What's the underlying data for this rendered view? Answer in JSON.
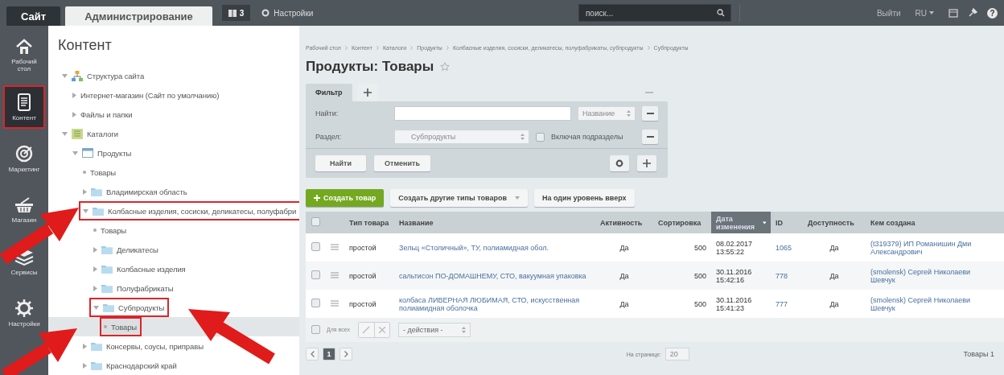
{
  "top_bar": {
    "tabs": [
      {
        "label": "Сайт",
        "selected": false
      },
      {
        "label": "Администрирование",
        "selected": true
      }
    ],
    "notifications": "3",
    "settings_link": "Настройки",
    "search": {
      "placeholder": "поиск..."
    },
    "logout": "Выйти",
    "language": "RU",
    "help": "?"
  },
  "rail": [
    {
      "label": "Рабочий стол",
      "kind": "home",
      "selected": false,
      "annotated": false
    },
    {
      "label": "Контент",
      "kind": "document",
      "selected": true,
      "annotated": true
    },
    {
      "label": "Маркетинг",
      "kind": "target",
      "selected": false,
      "annotated": false
    },
    {
      "label": "Магазин",
      "kind": "basket",
      "selected": false,
      "annotated": false
    },
    {
      "label": "Сервисы",
      "kind": "layers",
      "selected": false,
      "annotated": false
    },
    {
      "label": "Настройки",
      "kind": "gear",
      "selected": false,
      "annotated": false
    }
  ],
  "tree": {
    "title": "Контент",
    "items": [
      {
        "label": "Структура сайта",
        "kind": "structure",
        "expanded": true,
        "selected": false,
        "annotated": false,
        "children": [
          {
            "label": "Интернет-магазин (Сайт по умолчанию)",
            "kind": "plain",
            "expanded": false,
            "selected": false,
            "annotated": false
          },
          {
            "label": "Файлы и папки",
            "kind": "plain",
            "expanded": false,
            "selected": false,
            "annotated": false
          }
        ]
      },
      {
        "label": "Каталоги",
        "kind": "catalog",
        "expanded": true,
        "selected": false,
        "annotated": false,
        "children": [
          {
            "label": "Продукты",
            "kind": "iblock",
            "expanded": true,
            "selected": false,
            "annotated": false,
            "children": [
              {
                "label": "Товары",
                "kind": "leaf",
                "selected": false,
                "annotated": false
              },
              {
                "label": "Владимирская область",
                "kind": "folder",
                "expanded": false,
                "selected": false,
                "annotated": false
              },
              {
                "label": "Колбасные изделия, сосиски, деликатесы, полуфабри",
                "kind": "folder",
                "expanded": true,
                "selected": false,
                "annotated": true,
                "children": [
                  {
                    "label": "Товары",
                    "kind": "leaf",
                    "selected": false,
                    "annotated": false
                  },
                  {
                    "label": "Деликатесы",
                    "kind": "folder",
                    "expanded": false,
                    "selected": false,
                    "annotated": false
                  },
                  {
                    "label": "Колбасные изделия",
                    "kind": "folder",
                    "expanded": false,
                    "selected": false,
                    "annotated": false
                  },
                  {
                    "label": "Полуфабрикаты",
                    "kind": "folder",
                    "expanded": false,
                    "selected": false,
                    "annotated": false
                  },
                  {
                    "label": "Субпродукты",
                    "kind": "folder",
                    "expanded": true,
                    "selected": false,
                    "annotated": true,
                    "children": [
                      {
                        "label": "Товары",
                        "kind": "leaf",
                        "selected": true,
                        "annotated": true
                      }
                    ]
                  }
                ]
              },
              {
                "label": "Консервы, соусы, приправы",
                "kind": "folder",
                "expanded": false,
                "selected": false,
                "annotated": false
              },
              {
                "label": "Краснодарский край",
                "kind": "folder",
                "expanded": false,
                "selected": false,
                "annotated": false
              }
            ]
          }
        ]
      }
    ]
  },
  "breadcrumb": [
    "Рабочий стол",
    "Контент",
    "Каталоги",
    "Продукты",
    "Колбасные изделия, сосиски, деликатесы, полуфабрикаты, субпродукты",
    "Субпродукты"
  ],
  "page_title": "Продукты: Товары",
  "filter": {
    "tabs": [
      {
        "label": "Фильтр",
        "selected": true
      }
    ],
    "rows": [
      {
        "label": "Найти:",
        "kind": "search",
        "select": "Название"
      },
      {
        "label": "Раздел:",
        "kind": "section",
        "select": "Субпродукты",
        "checkbox": {
          "label": "Включая подразделы",
          "checked": false
        }
      }
    ],
    "buttons": [
      "Найти",
      "Отменить"
    ]
  },
  "toolbar": [
    {
      "label": "Создать товар",
      "kind": "primary"
    },
    {
      "label": "Создать другие типы товаров",
      "kind": "dropdown"
    },
    {
      "label": "На один уровень вверх",
      "kind": "plain"
    }
  ],
  "table": {
    "select_all": {
      "checked": false
    },
    "columns": [
      {
        "label": "Тип товара",
        "kind": "text",
        "sorted": false
      },
      {
        "label": "Название",
        "kind": "link",
        "sorted": false
      },
      {
        "label": "Активность",
        "kind": "center",
        "sorted": false
      },
      {
        "label": "Сортировка",
        "kind": "number",
        "sorted": false
      },
      {
        "label": "Дата изменения",
        "kind": "text",
        "sorted": true
      },
      {
        "label": "ID",
        "kind": "link",
        "sorted": false
      },
      {
        "label": "Доступность",
        "kind": "center",
        "sorted": false
      },
      {
        "label": "Кем создана",
        "kind": "link",
        "sorted": false
      }
    ],
    "rows": [
      {
        "checked": false,
        "cells": [
          "простой",
          "Зельц «Столичный», ТУ, полиамидная обол.",
          "Да",
          "500",
          "08.02.2017\n13:55:22",
          "1065",
          "Да",
          "(t319379) ИП Романишин Дми\nАлександрович"
        ]
      },
      {
        "checked": false,
        "cells": [
          "простой",
          "сальтисон ПО-ДОМАШНЕМУ, СТО, вакуумная упаковка",
          "Да",
          "500",
          "30.11.2016\n15:42:16",
          "778",
          "Да",
          "(smolensk) Сергей Николаеви\nШевчук"
        ]
      },
      {
        "checked": false,
        "cells": [
          "простой",
          "колбаса ЛИВЕРНАЯ ЛЮБИМАЯ, СТО, искусственная\nполиамидная оболочка",
          "Да",
          "500",
          "30.11.2016\n15:41:23",
          "777",
          "Да",
          "(smolensk) Сергей Николаеви\nШевчук"
        ]
      }
    ],
    "footer": {
      "checked": false,
      "all_label": "Для всех",
      "actions": "- действия -"
    }
  },
  "pagination": {
    "pages": [
      {
        "label": "1",
        "selected": true
      }
    ],
    "per_page_label": "На странице:",
    "per_page": "20",
    "total": "Товары 1"
  }
}
